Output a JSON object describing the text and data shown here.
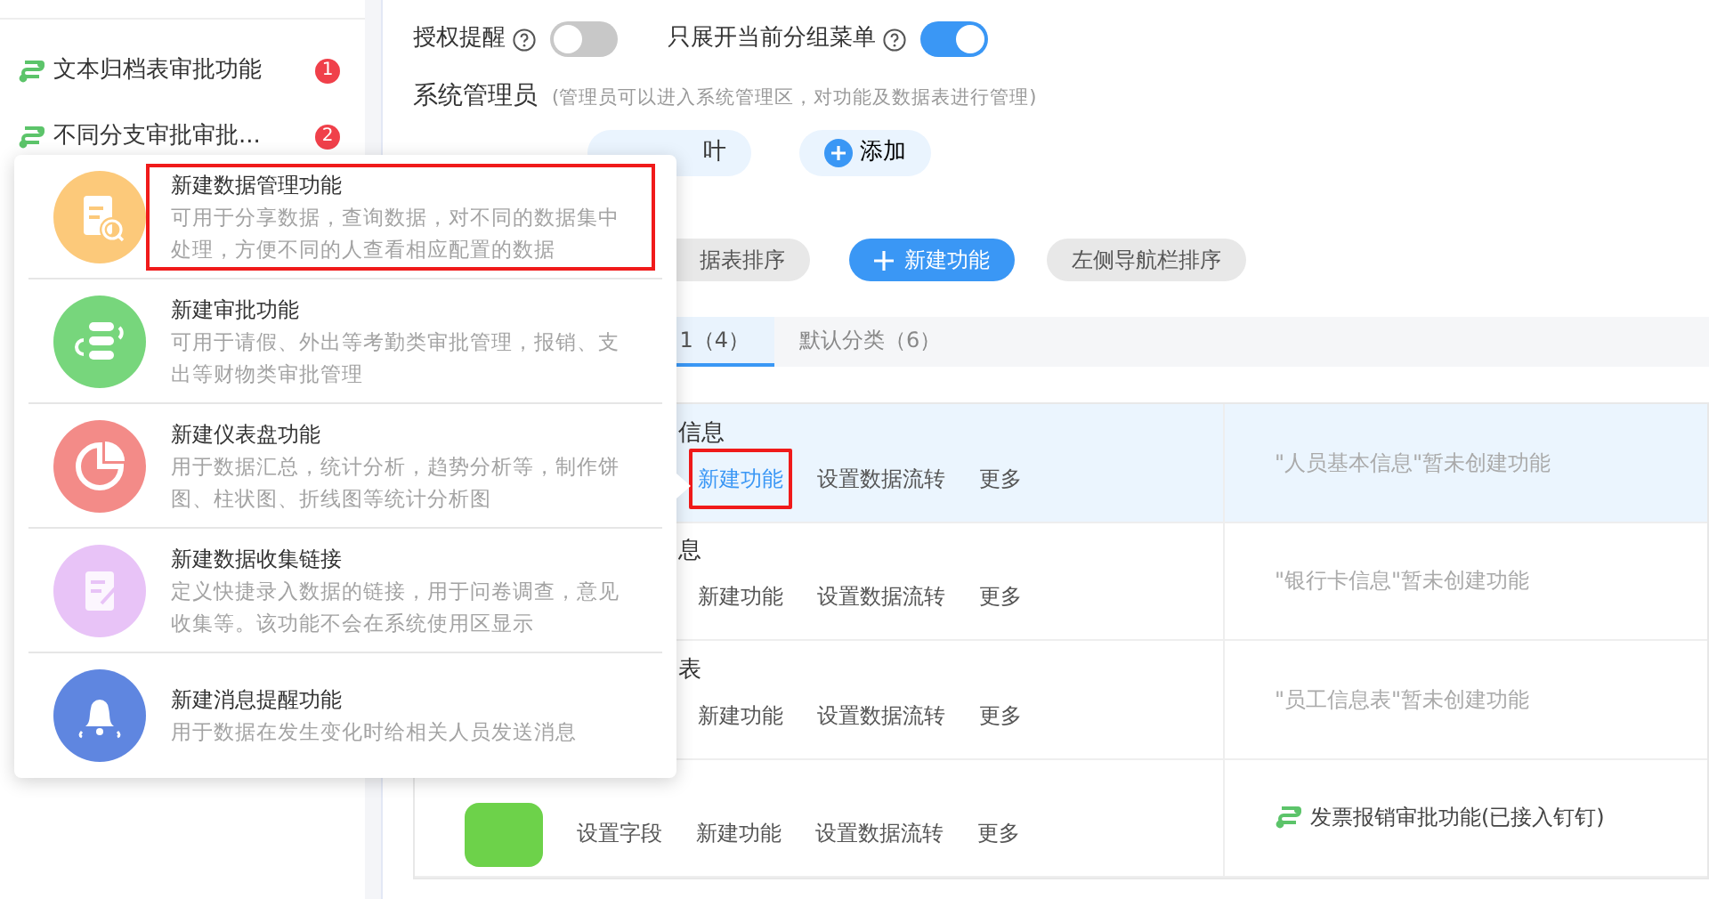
{
  "sidebar": {
    "items": [
      {
        "label": "文本归档表审批功能",
        "badge": "1"
      },
      {
        "label": "不同分支审批审批...",
        "badge": "2"
      }
    ]
  },
  "toggles": [
    {
      "label": "授权提醒",
      "on": false
    },
    {
      "label": "只展开当前分组菜单",
      "on": true
    }
  ],
  "admins": {
    "label": "系统管理员",
    "hint": "(管理员可以进入系统管理区，对功能及数据表进行管理)",
    "chips": [
      {
        "name": "叶"
      }
    ],
    "add_button": "添加"
  },
  "toolbar": [
    {
      "label": "据表排序",
      "kind": "secondary"
    },
    {
      "label": "新建功能",
      "kind": "primary"
    },
    {
      "label": "左侧导航栏排序",
      "kind": "secondary"
    }
  ],
  "tabs": [
    {
      "label": "1（4）",
      "selected": true
    },
    {
      "label": "默认分类（6）",
      "selected": false
    }
  ],
  "rows": [
    {
      "title": "信息",
      "selected": true,
      "actions": [
        {
          "label": "新建功能",
          "highlighted": true
        },
        {
          "label": "设置数据流转",
          "highlighted": false
        },
        {
          "label": "更多",
          "highlighted": false
        }
      ],
      "kind": "empty",
      "note": "\"人员基本信息\"暂未创建功能"
    },
    {
      "title": "息",
      "selected": false,
      "actions": [
        {
          "label": "新建功能",
          "highlighted": false
        },
        {
          "label": "设置数据流转",
          "highlighted": false
        },
        {
          "label": "更多",
          "highlighted": false
        }
      ],
      "kind": "empty",
      "note": "\"银行卡信息\"暂未创建功能"
    },
    {
      "title": "表",
      "selected": false,
      "actions": [
        {
          "label": "新建功能",
          "highlighted": false
        },
        {
          "label": "设置数据流转",
          "highlighted": false
        },
        {
          "label": "更多",
          "highlighted": false
        }
      ],
      "kind": "empty",
      "note": "\"员工信息表\"暂未创建功能"
    },
    {
      "selected": false,
      "actions": [
        {
          "label": "设置字段",
          "highlighted": false
        },
        {
          "label": "新建功能",
          "highlighted": false
        },
        {
          "label": "设置数据流转",
          "highlighted": false
        },
        {
          "label": "更多",
          "highlighted": false
        }
      ],
      "kind": "function",
      "note": "发票报销审批功能(已接入钉钉)"
    }
  ],
  "popup": {
    "items": [
      {
        "title": "新建数据管理功能",
        "description": "可用于分享数据，查询数据，对不同的数据集中处理，方便不同的人查看相应配置的数据",
        "color": "#fcc97a",
        "highlighted": true
      },
      {
        "title": "新建审批功能",
        "description": "可用于请假、外出等考勤类审批管理，报销、支出等财物类审批管理",
        "color": "#77d67c",
        "highlighted": false
      },
      {
        "title": "新建仪表盘功能",
        "description": "用于数据汇总，统计分析，趋势分析等，制作饼图、柱状图、折线图等统计分析图",
        "color": "#f38b88",
        "highlighted": false
      },
      {
        "title": "新建数据收集链接",
        "description": "定义快捷录入数据的链接，用于问卷调查，意见收集等。该功能不会在系统使用区显示",
        "color": "#e8c3f7",
        "highlighted": false
      },
      {
        "title": "新建消息提醒功能",
        "description": "用于数据在发生变化时给相关人员发送消息",
        "color": "#5f86e0",
        "highlighted": false
      }
    ]
  }
}
